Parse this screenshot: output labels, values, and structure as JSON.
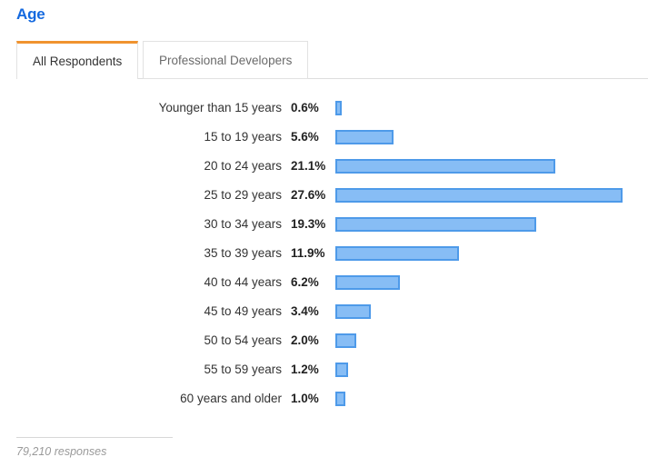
{
  "header": {
    "title": "Age",
    "title_color": "#1469df"
  },
  "tabs": [
    {
      "label": "All Respondents",
      "active": true
    },
    {
      "label": "Professional Developers",
      "active": false
    }
  ],
  "footer": {
    "responses": "79,210 responses"
  },
  "colors": {
    "bar_fill": "#87bdf5",
    "bar_border": "#4e9ae9",
    "active_tab_indicator": "#f0932f",
    "title": "#1469df"
  },
  "chart_data": {
    "type": "bar",
    "orientation": "horizontal",
    "title": "Age",
    "xlabel": "",
    "ylabel": "",
    "xlim": [
      0,
      27.6
    ],
    "grid": false,
    "legend": null,
    "value_suffix": "%",
    "categories": [
      "Younger than 15 years",
      "15 to 19 years",
      "20 to 24 years",
      "25 to 29 years",
      "30 to 34 years",
      "35 to 39 years",
      "40 to 44 years",
      "45 to 49 years",
      "50 to 54 years",
      "55 to 59 years",
      "60 years and older"
    ],
    "values": [
      0.6,
      5.6,
      21.1,
      27.6,
      19.3,
      11.9,
      6.2,
      3.4,
      2.0,
      1.2,
      1.0
    ],
    "value_labels": [
      "0.6%",
      "5.6%",
      "21.1%",
      "27.6%",
      "19.3%",
      "11.9%",
      "6.2%",
      "3.4%",
      "2.0%",
      "1.2%",
      "1.0%"
    ],
    "total_responses": "79,210 responses"
  }
}
